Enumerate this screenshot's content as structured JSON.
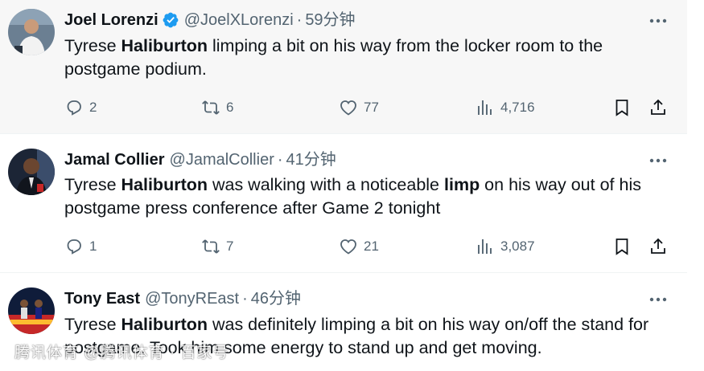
{
  "tweets": [
    {
      "name": "Joel Lorenzi",
      "verified": true,
      "handle": "@JoelXLorenzi",
      "dot": "·",
      "time": "59分钟",
      "text_parts": [
        "Tyrese ",
        "Haliburton",
        " limping a bit on his way from the locker room to the postgame podium."
      ],
      "replies": "2",
      "retweets": "6",
      "likes": "77",
      "views": "4,716"
    },
    {
      "name": "Jamal Collier",
      "verified": false,
      "handle": "@JamalCollier",
      "dot": "·",
      "time": "41分钟",
      "text_parts": [
        "Tyrese ",
        "Haliburton",
        " was walking with a noticeable ",
        "limp",
        " on his way out of his postgame press conference after Game 2 tonight"
      ],
      "replies": "1",
      "retweets": "7",
      "likes": "21",
      "views": "3,087"
    },
    {
      "name": "Tony East",
      "verified": false,
      "handle": "@TonyREast",
      "dot": "·",
      "time": "46分钟",
      "text_parts": [
        "Tyrese ",
        "Haliburton",
        " was definitely limping a bit on his way on/off the stand for postgame. Took him some energy to stand up and get moving."
      ]
    }
  ],
  "watermark": "腾讯体育 @腾讯体育 · 百家号",
  "colors": {
    "text": "#0f1419",
    "secondary": "#536471",
    "verified_blue": "#1d9bf0",
    "hover_bg": "#f7f7f7"
  },
  "icons": [
    "reply-icon",
    "retweet-icon",
    "like-icon",
    "views-icon",
    "bookmark-icon",
    "share-icon",
    "more-icon",
    "verified-icon"
  ]
}
